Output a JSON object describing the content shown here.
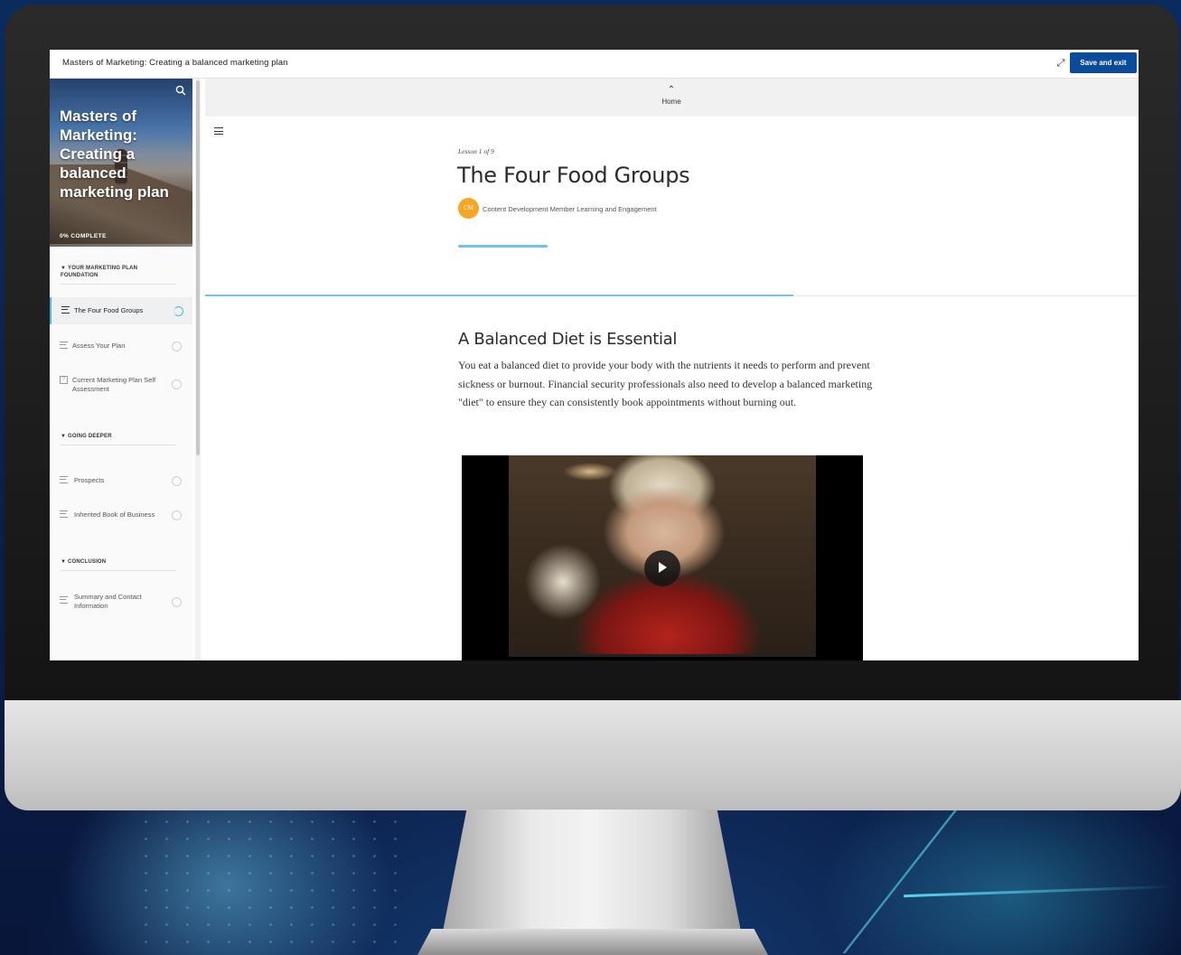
{
  "window": {
    "course_title": "Masters of Marketing: Creating a balanced marketing plan",
    "save_exit_label": "Save and exit",
    "expand_icon": "expand-icon"
  },
  "sidebar": {
    "title": "Masters of Marketing: Creating a balanced marketing plan",
    "progress_label": "0% COMPLETE",
    "progress_value": 0,
    "sections": [
      {
        "heading": "YOUR MARKETING PLAN FOUNDATION",
        "lessons": [
          {
            "label": "The Four Food Groups",
            "icon": "lines-icon",
            "active": true
          },
          {
            "label": "Assess Your Plan",
            "icon": "lines-icon",
            "active": false
          },
          {
            "label": "Current Marketing Plan Self Assessment",
            "icon": "quiz-icon",
            "active": false
          }
        ]
      },
      {
        "heading": "GOING DEEPER",
        "lessons": [
          {
            "label": "Prospects",
            "icon": "lines-icon",
            "active": false
          },
          {
            "label": "Inherited Book of Business",
            "icon": "lines-icon",
            "active": false
          }
        ]
      },
      {
        "heading": "CONCLUSION",
        "lessons": [
          {
            "label": "Summary and Contact Information",
            "icon": "lines-icon",
            "active": false
          }
        ]
      }
    ],
    "accent_color": "#4fb7e6"
  },
  "main": {
    "home_label": "Home",
    "lesson_count": "Lesson 1 of 9",
    "lesson_title": "The Four Food Groups",
    "author_initials": "CM",
    "author_name": "Content Development Member Learning and Engagement",
    "reading_progress": 0.63,
    "section_title": "A Balanced Diet is Essential",
    "body_text": "You eat a balanced diet to provide your body with the nutrients it needs to perform and prevent sickness or burnout. Financial security professionals also need to develop a balanced marketing \"diet\" to ensure they can consistently book appointments without burning out.",
    "avatar_color": "#f5a623",
    "button_color": "#0a4c99"
  }
}
